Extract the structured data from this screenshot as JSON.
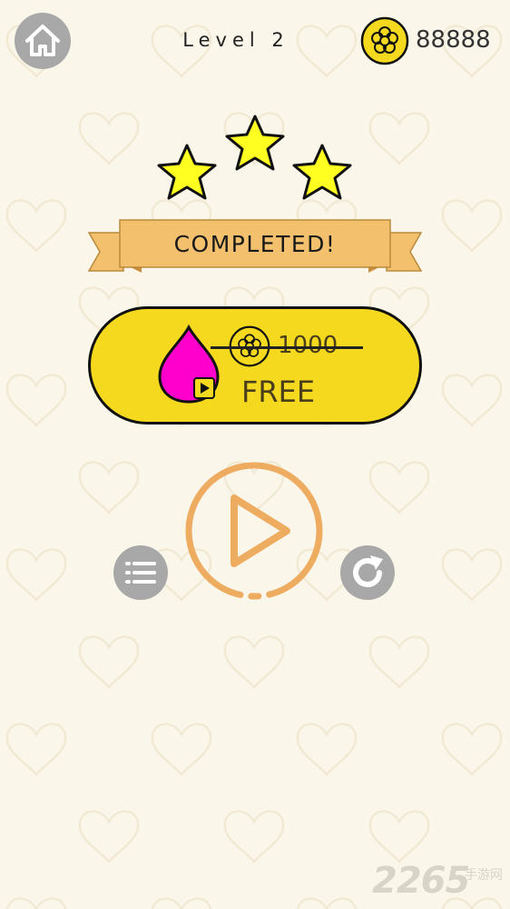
{
  "header": {
    "home_icon": "home-icon",
    "level_label": "Level 2",
    "coin_icon": "flower-coin-icon",
    "coins": "88888"
  },
  "result": {
    "stars_earned": 3,
    "stars_total": 3,
    "banner_text": "COMPLETED!"
  },
  "reward": {
    "item_icon": "drop-icon",
    "ad_icon": "video-play-icon",
    "price_icon": "flower-coin-icon",
    "price": "1000",
    "free_label": "FREE"
  },
  "actions": {
    "play_icon": "play-icon",
    "menu_icon": "list-icon",
    "retry_icon": "refresh-icon"
  },
  "watermark": {
    "brand": "2265",
    "suffix": "手游网"
  },
  "colors": {
    "background": "#fbf6ea",
    "button_yellow": "#f5d91f",
    "star_yellow": "#ffff22",
    "ribbon": "#f3c06d",
    "drop_magenta": "#ff00cc",
    "play_orange": "#eeac60",
    "icon_gray": "#a8a8a8"
  }
}
